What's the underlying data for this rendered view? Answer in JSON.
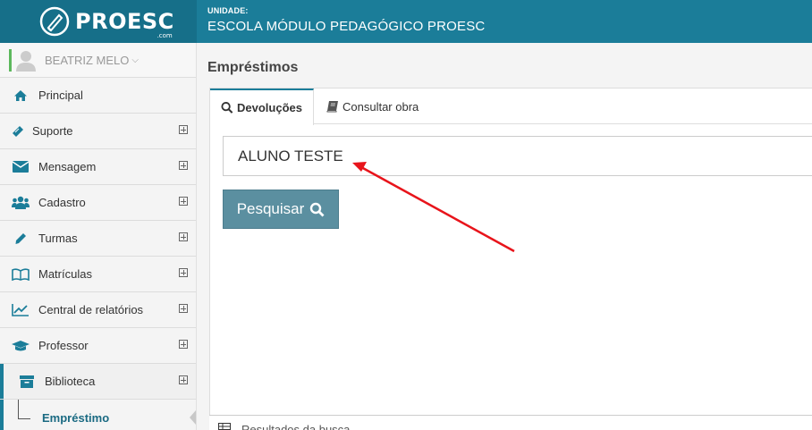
{
  "brand": {
    "logo_text": "PROESC",
    "logo_sub": ".com"
  },
  "header": {
    "unit_label": "UNIDADE:",
    "unit_name": "ESCOLA MÓDULO PEDAGÓGICO PROESC"
  },
  "user": {
    "name": "BEATRIZ MELO",
    "caret": "⌵"
  },
  "sidebar": {
    "items": [
      {
        "label": "Principal",
        "icon": "home-icon"
      },
      {
        "label": "Suporte",
        "icon": "ticket-icon"
      },
      {
        "label": "Mensagem",
        "icon": "envelope-icon"
      },
      {
        "label": "Cadastro",
        "icon": "users-icon"
      },
      {
        "label": "Turmas",
        "icon": "pencil-icon"
      },
      {
        "label": "Matrículas",
        "icon": "book-open-icon"
      },
      {
        "label": "Central de relatórios",
        "icon": "chart-line-icon"
      },
      {
        "label": "Professor",
        "icon": "graduation-cap-icon"
      },
      {
        "label": "Biblioteca",
        "icon": "archive-icon"
      }
    ],
    "submenu_label": "Empréstimo"
  },
  "main": {
    "title": "Empréstimos",
    "tabs": [
      {
        "label": "Devoluções",
        "icon": "search-icon"
      },
      {
        "label": "Consultar obra",
        "icon": "book-icon"
      }
    ],
    "search_value": "ALUNO TESTE",
    "search_button": "Pesquisar",
    "results_label": "Resultados da busca"
  },
  "colors": {
    "brand": "#1b7d99",
    "button": "#5b8fa0",
    "annotation_arrow": "#e8141b"
  }
}
